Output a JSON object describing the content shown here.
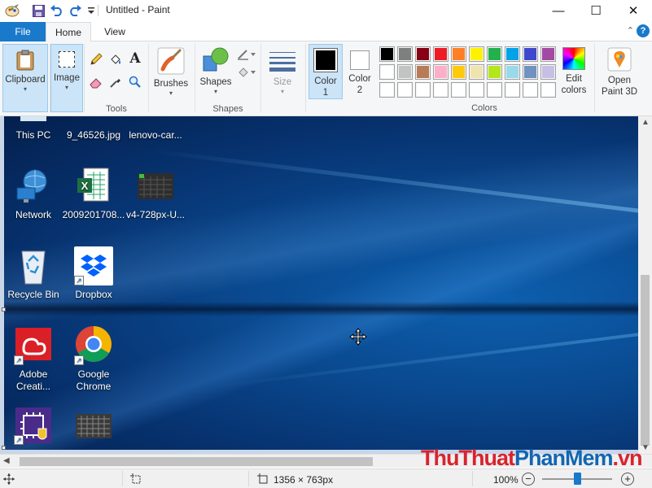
{
  "window": {
    "title": "Untitled - Paint",
    "minimize_glyph": "—",
    "maximize_glyph": "☐",
    "close_glyph": "✕"
  },
  "tabs": {
    "file": "File",
    "home": "Home",
    "view": "View",
    "collapse_glyph": "⌃",
    "help_glyph": "?"
  },
  "ribbon": {
    "clipboard": "Clipboard",
    "image": "Image",
    "tools_group": "Tools",
    "brushes": "Brushes",
    "shapes": "Shapes",
    "shapes_group": "Shapes",
    "size": "Size",
    "color1_line1": "Color",
    "color1_line2": "1",
    "color2_line1": "Color",
    "color2_line2": "2",
    "colors_group": "Colors",
    "edit_colors_line1": "Edit",
    "edit_colors_line2": "colors",
    "open_paint3d_line1": "Open",
    "open_paint3d_line2": "Paint 3D",
    "text_tool_glyph": "A",
    "dropdown_glyph": "▾"
  },
  "colors": {
    "color1": "#000000",
    "color2": "#ffffff",
    "palette_row1": [
      "#000000",
      "#7f7f7f",
      "#880015",
      "#ed1c24",
      "#ff7f27",
      "#fff200",
      "#22b14c",
      "#00a2e8",
      "#3f48cc",
      "#a349a4"
    ],
    "palette_row2": [
      "#ffffff",
      "#c3c3c3",
      "#b97a57",
      "#ffaec9",
      "#ffc90e",
      "#efe4b0",
      "#b5e61d",
      "#99d9ea",
      "#7092be",
      "#c8bfe7"
    ],
    "palette_row3": [
      "#ffffff",
      "#ffffff",
      "#ffffff",
      "#ffffff",
      "#ffffff",
      "#ffffff",
      "#ffffff",
      "#ffffff",
      "#ffffff",
      "#ffffff"
    ]
  },
  "desktop_icons": [
    {
      "label": "This PC",
      "icon": "this-pc-icon"
    },
    {
      "label": "9_46526.jpg",
      "icon": "image-file-icon"
    },
    {
      "label": "lenovo-car...",
      "icon": "image-file-icon"
    },
    {
      "label": "Network",
      "icon": "network-icon"
    },
    {
      "label": "2009201708...",
      "icon": "excel-file-icon"
    },
    {
      "label": "v4-728px-U...",
      "icon": "image-thumbnail-icon"
    },
    {
      "label": "Recycle Bin",
      "icon": "recycle-bin-icon"
    },
    {
      "label": "Dropbox",
      "icon": "dropbox-icon"
    },
    {
      "label": "Adobe Creati...",
      "icon": "adobe-creative-cloud-icon"
    },
    {
      "label": "Google Chrome",
      "icon": "google-chrome-icon"
    }
  ],
  "desktop_icon_lines": {
    "adobe_line1": "Adobe",
    "adobe_line2": "Creati...",
    "chrome_line1": "Google",
    "chrome_line2": "Chrome"
  },
  "statusbar": {
    "image_size": "1356 × 763px",
    "zoom": "100%",
    "zoom_out_glyph": "−",
    "zoom_in_glyph": "+",
    "zoom_level": 0.5
  },
  "watermark": {
    "part1": "ThuThuat",
    "part2": "PhanMem",
    "part3": ".vn"
  },
  "scroll": {
    "up": "▲",
    "down": "▼",
    "left": "◀",
    "right": "▶"
  }
}
